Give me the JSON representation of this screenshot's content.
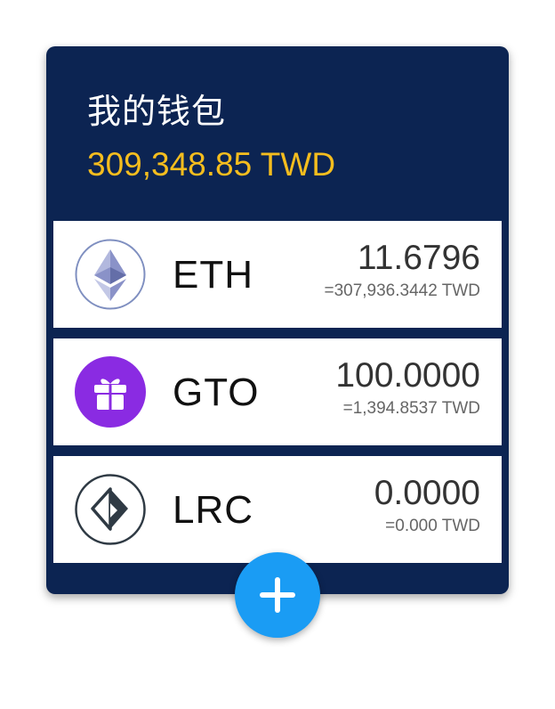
{
  "wallet": {
    "title": "我的钱包",
    "total": "309,348.85 TWD"
  },
  "coins": [
    {
      "symbol": "ETH",
      "amount": "11.6796",
      "fiat": "=307,936.3442 TWD",
      "icon": "ethereum-icon"
    },
    {
      "symbol": "GTO",
      "amount": "100.0000",
      "fiat": "=1,394.8537 TWD",
      "icon": "gift-icon"
    },
    {
      "symbol": "LRC",
      "amount": "0.0000",
      "fiat": "=0.000 TWD",
      "icon": "loopring-icon"
    }
  ],
  "colors": {
    "card_background": "#0c2452",
    "total_text": "#f5bd1e",
    "add_button": "#1a9cf4",
    "gto_icon": "#8a2be2"
  },
  "add_button": {
    "icon": "plus-icon"
  }
}
